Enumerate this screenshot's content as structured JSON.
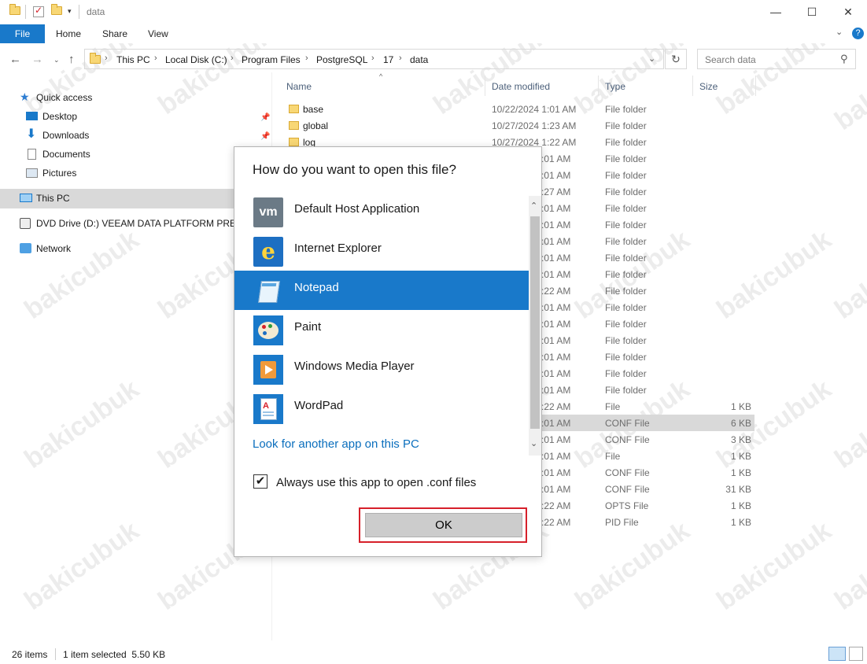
{
  "window": {
    "title": "data",
    "controls": {
      "minimize": "—",
      "maximize": "☐",
      "close": "✕"
    }
  },
  "ribbon": {
    "tabs": [
      "File",
      "Home",
      "Share",
      "View"
    ],
    "help": "?"
  },
  "address": {
    "crumbs": [
      "This PC",
      "Local Disk (C:)",
      "Program Files",
      "PostgreSQL",
      "17",
      "data"
    ],
    "search_placeholder": "Search data"
  },
  "nav": {
    "items": [
      {
        "label": "Quick access",
        "icon": "star-icon"
      },
      {
        "label": "Desktop",
        "icon": "desktop-icon"
      },
      {
        "label": "Downloads",
        "icon": "download-icon"
      },
      {
        "label": "Documents",
        "icon": "documents-icon"
      },
      {
        "label": "Pictures",
        "icon": "pictures-icon"
      },
      {
        "label": "This PC",
        "icon": "pc-icon"
      },
      {
        "label": "DVD Drive (D:) VEEAM DATA PLATFORM PREMIU",
        "icon": "dvd-icon"
      },
      {
        "label": "Network",
        "icon": "network-icon"
      }
    ]
  },
  "columns": {
    "name": "Name",
    "date": "Date modified",
    "type": "Type",
    "size": "Size"
  },
  "files": [
    {
      "name": "base",
      "date": "10/22/2024 1:01 AM",
      "type": "File folder",
      "size": ""
    },
    {
      "name": "global",
      "date": "10/27/2024 1:23 AM",
      "type": "File folder",
      "size": ""
    },
    {
      "name": "log",
      "date": "10/27/2024 1:22 AM",
      "type": "File folder",
      "size": ""
    },
    {
      "name": "",
      "date": ":01 AM",
      "type": "File folder",
      "size": ""
    },
    {
      "name": "",
      "date": ":01 AM",
      "type": "File folder",
      "size": ""
    },
    {
      "name": "",
      "date": ":27 AM",
      "type": "File folder",
      "size": ""
    },
    {
      "name": "",
      "date": ":01 AM",
      "type": "File folder",
      "size": ""
    },
    {
      "name": "",
      "date": ":01 AM",
      "type": "File folder",
      "size": ""
    },
    {
      "name": "",
      "date": ":01 AM",
      "type": "File folder",
      "size": ""
    },
    {
      "name": "",
      "date": ":01 AM",
      "type": "File folder",
      "size": ""
    },
    {
      "name": "",
      "date": ":01 AM",
      "type": "File folder",
      "size": ""
    },
    {
      "name": "",
      "date": ":22 AM",
      "type": "File folder",
      "size": ""
    },
    {
      "name": "",
      "date": ":01 AM",
      "type": "File folder",
      "size": ""
    },
    {
      "name": "",
      "date": ":01 AM",
      "type": "File folder",
      "size": ""
    },
    {
      "name": "",
      "date": ":01 AM",
      "type": "File folder",
      "size": ""
    },
    {
      "name": "",
      "date": ":01 AM",
      "type": "File folder",
      "size": ""
    },
    {
      "name": "",
      "date": ":01 AM",
      "type": "File folder",
      "size": ""
    },
    {
      "name": "",
      "date": ":01 AM",
      "type": "File folder",
      "size": ""
    },
    {
      "name": "",
      "date": ":22 AM",
      "type": "File",
      "size": "1 KB"
    },
    {
      "name": "",
      "date": ":01 AM",
      "type": "CONF File",
      "size": "6 KB"
    },
    {
      "name": "",
      "date": ":01 AM",
      "type": "CONF File",
      "size": "3 KB"
    },
    {
      "name": "",
      "date": ":01 AM",
      "type": "File",
      "size": "1 KB"
    },
    {
      "name": "",
      "date": ":01 AM",
      "type": "CONF File",
      "size": "1 KB"
    },
    {
      "name": "",
      "date": ":01 AM",
      "type": "CONF File",
      "size": "31 KB"
    },
    {
      "name": "",
      "date": ":22 AM",
      "type": "OPTS File",
      "size": "1 KB"
    },
    {
      "name": "",
      "date": ":22 AM",
      "type": "PID File",
      "size": "1 KB"
    }
  ],
  "status": {
    "items": "26 items",
    "selection": "1 item selected  5.50 KB"
  },
  "dialog": {
    "title": "How do you want to open this file?",
    "apps": [
      {
        "label": "Default Host Application",
        "icon": "vmware-icon"
      },
      {
        "label": "Internet Explorer",
        "icon": "internet-explorer-icon"
      },
      {
        "label": "Notepad",
        "icon": "notepad-icon",
        "selected": true
      },
      {
        "label": "Paint",
        "icon": "paint-icon"
      },
      {
        "label": "Windows Media Player",
        "icon": "media-player-icon"
      },
      {
        "label": "WordPad",
        "icon": "wordpad-icon"
      }
    ],
    "look_link": "Look for another app on this PC",
    "always_use": "Always use this app to open .conf files",
    "always_checked": true,
    "ok": "OK"
  },
  "watermark": "bakicubuk"
}
